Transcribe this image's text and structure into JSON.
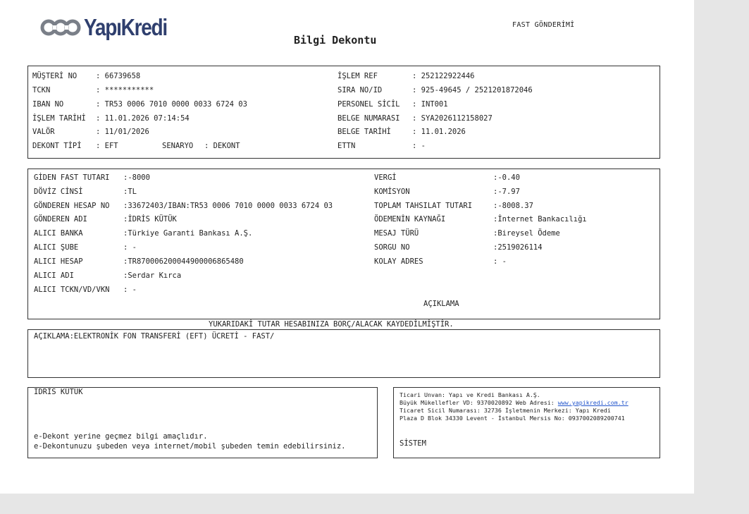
{
  "header": {
    "brand": "YapıKredi",
    "doc_type": "FAST GÖNDERİMİ",
    "title": "Bilgi Dekontu"
  },
  "info": {
    "musteri_no_label": "MÜŞTERİ NO",
    "musteri_no": ": 66739658",
    "tckn_label": "TCKN",
    "tckn": ": ***********",
    "iban_label": "IBAN NO",
    "iban": ": TR53 0006 7010 0000 0033 6724 03",
    "islem_tarihi_label": "İŞLEM TARİHİ",
    "islem_tarihi": ": 11.01.2026 07:14:54",
    "valor_label": "VALÖR",
    "valor": ": 11/01/2026",
    "dekont_tipi_label": "DEKONT TİPİ",
    "dekont_tipi": ": EFT",
    "senaryo_label": "SENARYO",
    "senaryo": ": DEKONT",
    "islem_ref_label": "İŞLEM REF",
    "islem_ref": ": 252122922446",
    "sira_no_label": "SIRA NO/ID",
    "sira_no": ": 925-49645 / 2521201872046",
    "personel_label": "PERSONEL SİCİL",
    "personel": ": INT001",
    "belge_no_label": "BELGE NUMARASI",
    "belge_no": ": SYA2026112158027",
    "belge_tarihi_label": "BELGE TARİHİ",
    "belge_tarihi": ": 11.01.2026",
    "ettn_label": "ETTN",
    "ettn": ": -"
  },
  "transfer": {
    "tutar_label": "GİDEN FAST TUTARI",
    "tutar": ":-8000",
    "doviz_label": "DÖVİZ CİNSİ",
    "doviz": ":TL",
    "gonderen_hesap_label": "GÖNDEREN HESAP NO",
    "gonderen_hesap": ":33672403/IBAN:TR53 0006 7010 0000 0033 6724 03",
    "gonderen_adi_label": "GÖNDEREN ADI",
    "gonderen_adi": ":İDRİS KÜTÜK",
    "alici_banka_label": "ALICI BANKA",
    "alici_banka": ":Türkiye Garanti Bankası A.Ş.",
    "alici_sube_label": "ALICI ŞUBE",
    "alici_sube": ": -",
    "alici_hesap_label": "ALICI HESAP",
    "alici_hesap": ":TR870006200044900006865480",
    "alici_adi_label": "ALICI ADI",
    "alici_adi": ":Serdar Kırca",
    "alici_tckn_label": "ALICI TCKN/VD/VKN",
    "alici_tckn": ": -",
    "vergi_label": "VERGİ",
    "vergi": ":-0.40",
    "komisyon_label": "KOMİSYON",
    "komisyon": ":-7.97",
    "toplam_label": "TOPLAM TAHSILAT TUTARI",
    "toplam": ":-8008.37",
    "odeme_label": "ÖDEMENİN KAYNAĞI",
    "odeme": ":İnternet Bankacılığı",
    "mesaj_label": "MESAJ TÜRÜ",
    "mesaj": ":Bireysel Ödeme",
    "sorgu_label": "SORGU NO",
    "sorgu": ":2519026114",
    "kolay_label": "KOLAY ADRES",
    "kolay": ": -",
    "aciklama_heading": "AÇIKLAMA"
  },
  "notice": "YUKARIDAKİ TUTAR HESABINIZA BORÇ/ALACAK KAYDEDİLMİŞTİR.",
  "description": "AÇIKLAMA:ELEKTRONİK FON TRANSFERİ (EFT) ÜCRETİ - FAST/",
  "footer_left": {
    "name": "İDRİS KÜTÜK",
    "note1": "e-Dekont yerine geçmez bilgi amaçlıdır.",
    "note2": "e-Dekontunuzu şubeden veya internet/mobil şubeden temin edebilirsiniz."
  },
  "footer_right": {
    "line1": "Ticari Unvan: Yapı ve Kredi Bankası A.Ş.",
    "line2_prefix": "Büyük Mükellefler VD: 9370020892 Web Adresi: ",
    "website": "www.yapikredi.com.tr",
    "line3": "Ticaret Sicil Numarası: 32736 İşletmenin Merkezi: Yapı Kredi",
    "line4": "Plaza D Blok 34330 Levent - İstanbul Mersis No: 0937002089200741",
    "system": "SİSTEM"
  },
  "colors": {
    "brand": "#2f3f6e",
    "link": "#2255cc",
    "border": "#333333"
  }
}
